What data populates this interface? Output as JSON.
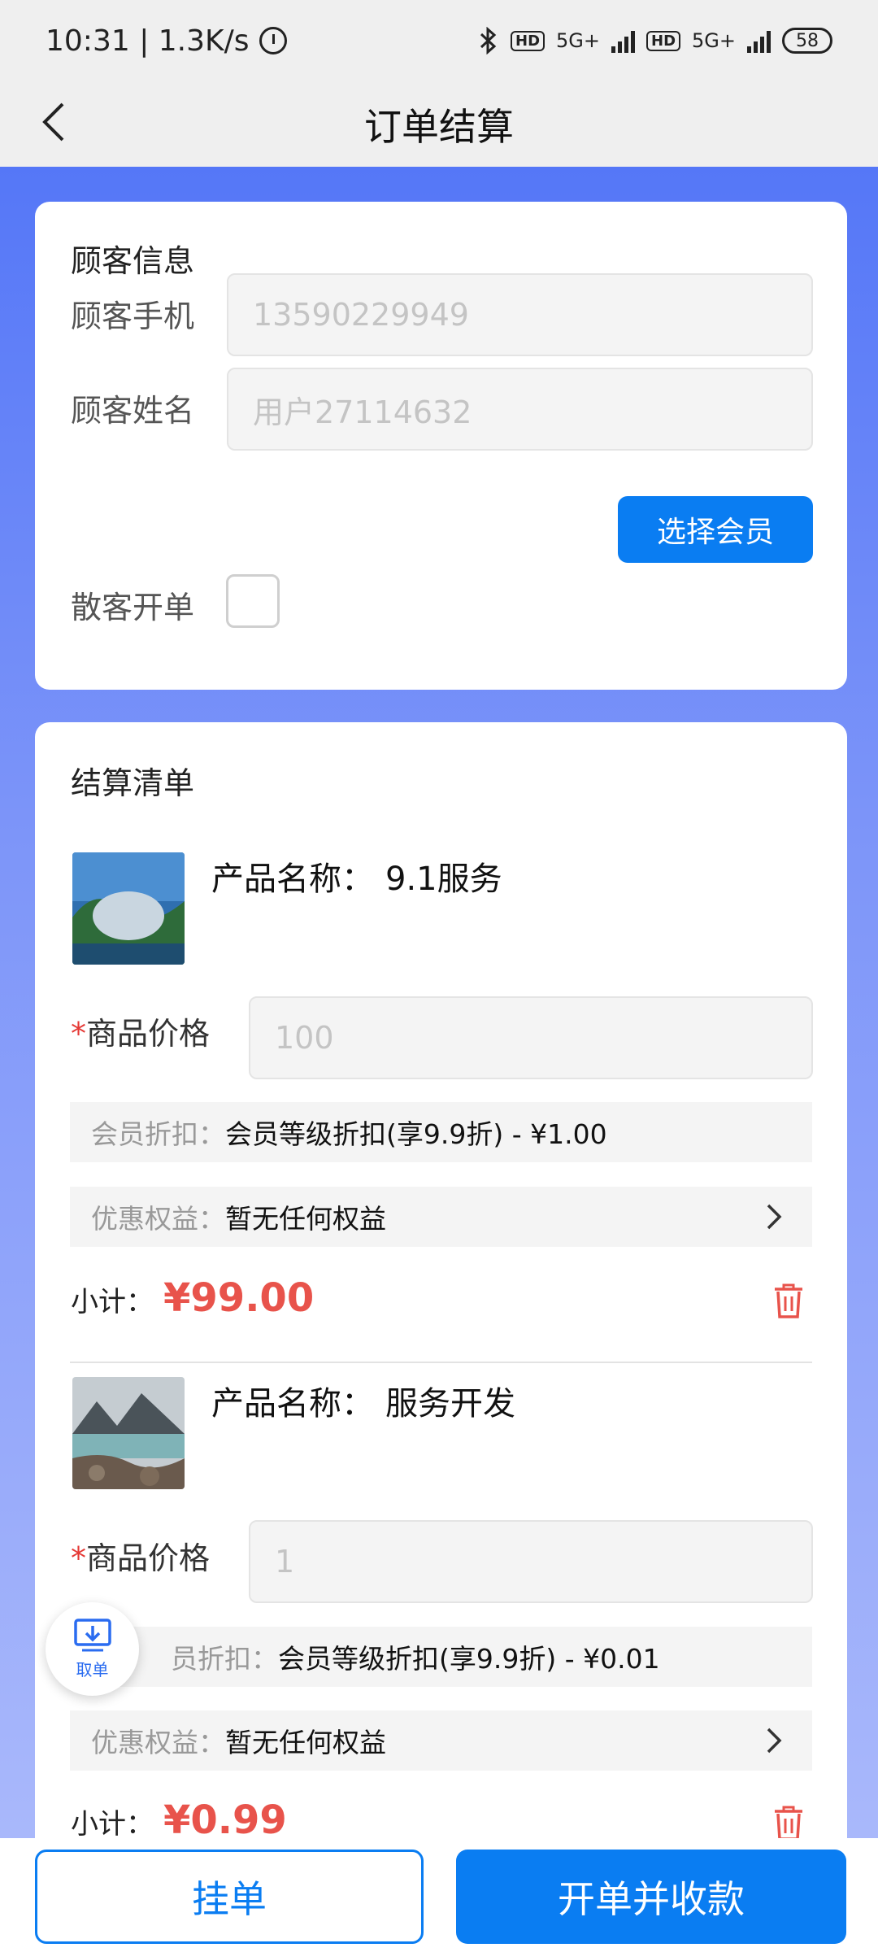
{
  "status_bar": {
    "time": "10:31 | 1.3K/s",
    "hd1": "HD",
    "net1": "5G+",
    "hd2": "HD",
    "net2": "5G+",
    "battery": "58"
  },
  "header": {
    "title": "订单结算"
  },
  "customer": {
    "section_title": "顾客信息",
    "phone_label": "顾客手机",
    "phone_placeholder": "13590229949",
    "name_label": "顾客姓名",
    "name_placeholder": "用户27114632",
    "select_member_label": "选择会员",
    "walkin_label": "散客开单"
  },
  "checkout": {
    "section_title": "结算清单",
    "items": [
      {
        "name_label": "产品名称：",
        "name": "9.1服务",
        "price_required": "*",
        "price_label": "商品价格",
        "price_placeholder": "100",
        "discount_label": "会员折扣：",
        "discount_value": "会员等级折扣(享9.9折) - ¥1.00",
        "benefit_label": "优惠权益：",
        "benefit_value": "暂无任何权益",
        "subtotal_label": "小计：",
        "subtotal_value": "¥99.00"
      },
      {
        "name_label": "产品名称：",
        "name": "服务开发",
        "price_required": "*",
        "price_label": "商品价格",
        "price_placeholder": "1",
        "discount_label": "员折扣：",
        "discount_value": "会员等级折扣(享9.9折) - ¥0.01",
        "benefit_label": "优惠权益：",
        "benefit_value": "暂无任何权益",
        "subtotal_label": "小计：",
        "subtotal_value": "¥0.99"
      }
    ]
  },
  "float_button": {
    "label": "取单"
  },
  "footer": {
    "hold_label": "挂单",
    "pay_label": "开单并收款"
  },
  "colors": {
    "primary": "#0a7df2",
    "price_red": "#e8534b",
    "gradient_top": "#5577f7"
  }
}
